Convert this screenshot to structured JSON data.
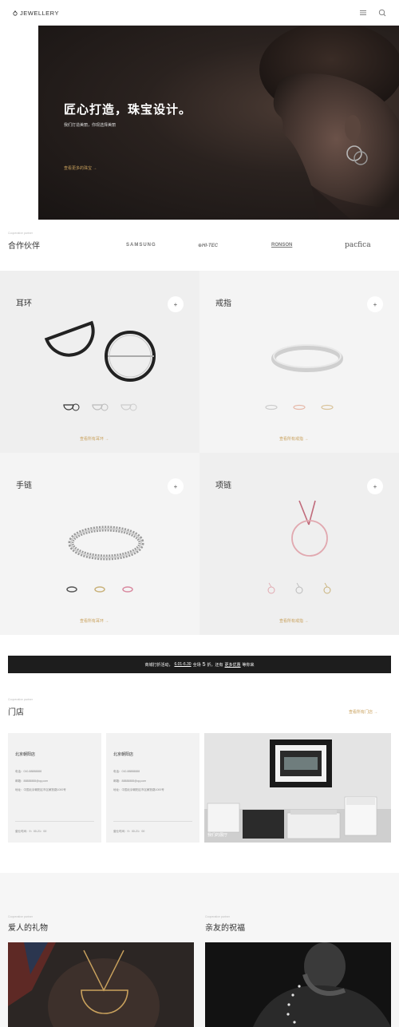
{
  "brand": {
    "logo_text": "JEWELLERY"
  },
  "header": {
    "menu_icon": "hamburger-menu-icon",
    "search_icon": "search-icon"
  },
  "hero": {
    "title": "匠心打造，珠宝设计。",
    "subtitle": "我们打造美丽，你现选择美丽",
    "link": "查看更多的珠宝 →"
  },
  "partners": {
    "tiny_label": "Cooperative partner",
    "title": "合作伙伴",
    "logos": [
      "SAMSUNG",
      "⊕HI-TEC",
      "RONSON",
      "pacfica"
    ]
  },
  "categories": [
    {
      "title": "耳环",
      "plus": "+",
      "link": "查看所有耳环 →"
    },
    {
      "title": "戒指",
      "plus": "+",
      "link": "查看所有戒指 →"
    },
    {
      "title": "手链",
      "plus": "+",
      "link": "查看所有耳环 →"
    },
    {
      "title": "项链",
      "plus": "+",
      "link": "查看所有戒指 →"
    }
  ],
  "promo": {
    "prefix": "商城打折活动，",
    "dates": "6.01-6.30",
    "middle": "全场",
    "discount": "5",
    "after": "折，还有",
    "more": "更多优惠",
    "suffix": "等你来"
  },
  "stores": {
    "tiny_label": "Cooperative partner",
    "title": "门店",
    "view_all": "查看所有门店 →",
    "cards": [
      {
        "name": "北京朝阳店",
        "phone": "电话：010-88888888",
        "email": "邮箱：88888888@qq.com",
        "address": "地址：中国北京朝阳区市区解放路1000号",
        "hours": "营业时间：9：00-21：00"
      },
      {
        "name": "北京朝阳店",
        "phone": "电话：010-88888888",
        "email": "邮箱：88888888@qq.com",
        "address": "地址：中国北京朝阳区市区解放路1000号",
        "hours": "营业时间：9：00-21：00"
      }
    ],
    "photo_caption": "我们的展厅"
  },
  "gifts": [
    {
      "tiny_label": "Cooperative partner",
      "title": "爱人的礼物"
    },
    {
      "tiny_label": "Cooperative partner",
      "title": "亲友的祝福"
    }
  ],
  "colors": {
    "accent": "#c9a15d",
    "dark": "#1d1d1d",
    "tile_bg": "#f0f0f0"
  }
}
